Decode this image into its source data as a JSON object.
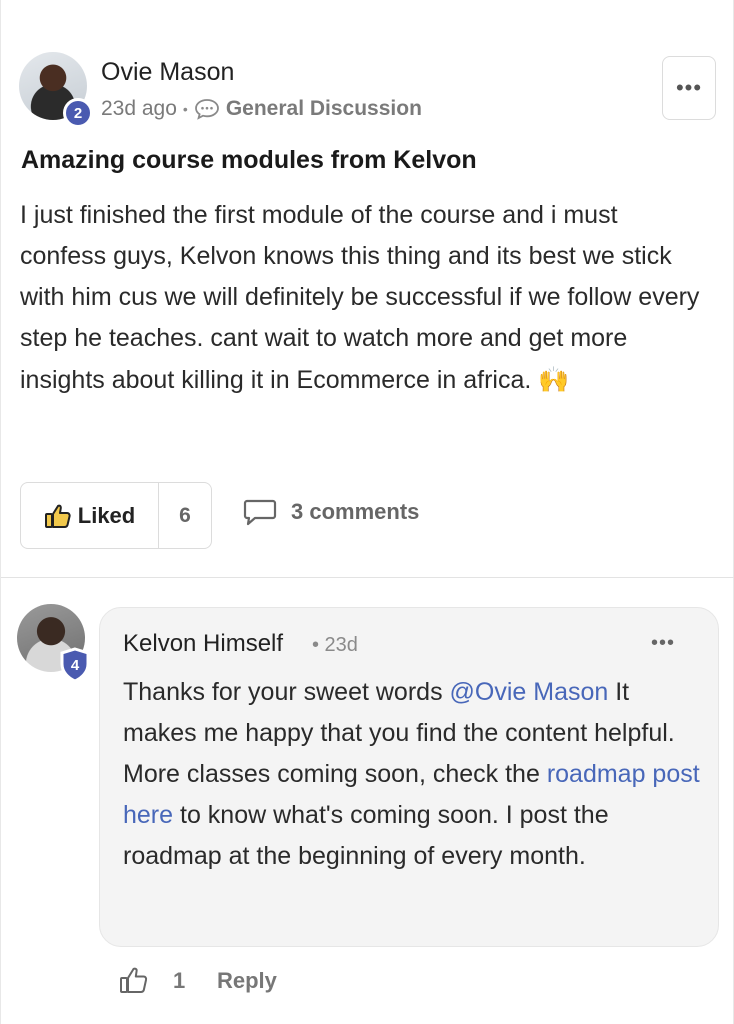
{
  "post": {
    "author": "Ovie Mason",
    "badge_level": "2",
    "time": "23d ago",
    "separator": "•",
    "category": "General Discussion",
    "more_label": "•••",
    "title": "Amazing course modules from Kelvon",
    "body": "I just finished the first module of the course and i must confess guys, Kelvon knows this thing and its best we stick with him cus we will definitely be successful if we follow every step he teaches. cant wait to watch more and get more insights about killing it in Ecommerce in africa. ",
    "emoji": "🙌",
    "liked_label": "Liked",
    "like_count": "6",
    "comments_label": "3 comments"
  },
  "comment": {
    "author": "Kelvon Himself",
    "time": "• 23d",
    "badge_level": "4",
    "more_label": "•••",
    "body_part1": "Thanks for your sweet words ",
    "mention": "@Ovie Mason",
    "body_part2": " It makes me happy that you find the content helpful. More classes coming soon, check the ",
    "link_text": "roadmap post here",
    "body_part3": " to know what's coming soon. I post the roadmap at the beginning of every month.",
    "like_count": "1",
    "reply_label": "Reply"
  },
  "colors": {
    "accent_link": "#4867b9",
    "badge": "#4a5ab0",
    "muted_text": "#7a7a7a",
    "bubble_bg": "#f4f4f4"
  },
  "icons": [
    "chat-bubble-icon",
    "thumbs-up-filled-icon",
    "comment-icon",
    "thumbs-up-outline-icon",
    "shield-badge-icon",
    "more-horizontal-icon"
  ]
}
